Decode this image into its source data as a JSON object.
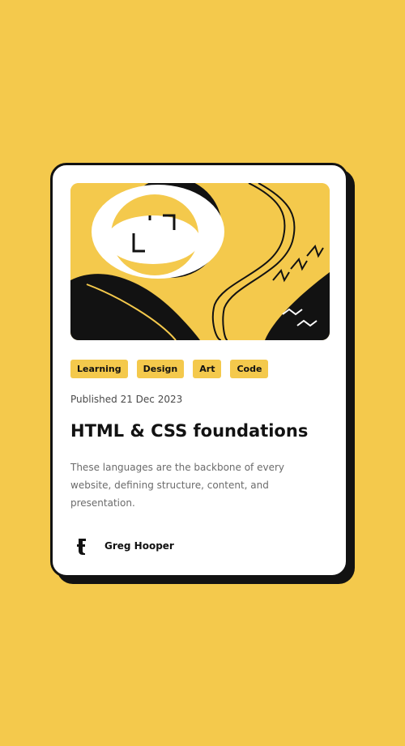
{
  "colors": {
    "background": "#f4c94c",
    "card": "#ffffff",
    "ink": "#121212",
    "muted": "#6b6b6b"
  },
  "hero": {
    "icon": "abstract-illustration"
  },
  "tags": [
    "Learning",
    "Design",
    "Art",
    "Code"
  ],
  "published": "Published 21 Dec 2023",
  "title": "HTML & CSS foundations",
  "description": "These languages are the backbone of every website, defining structure, content, and presentation.",
  "author": {
    "name": "Greg Hooper",
    "avatar_icon": "avatar-icon"
  }
}
